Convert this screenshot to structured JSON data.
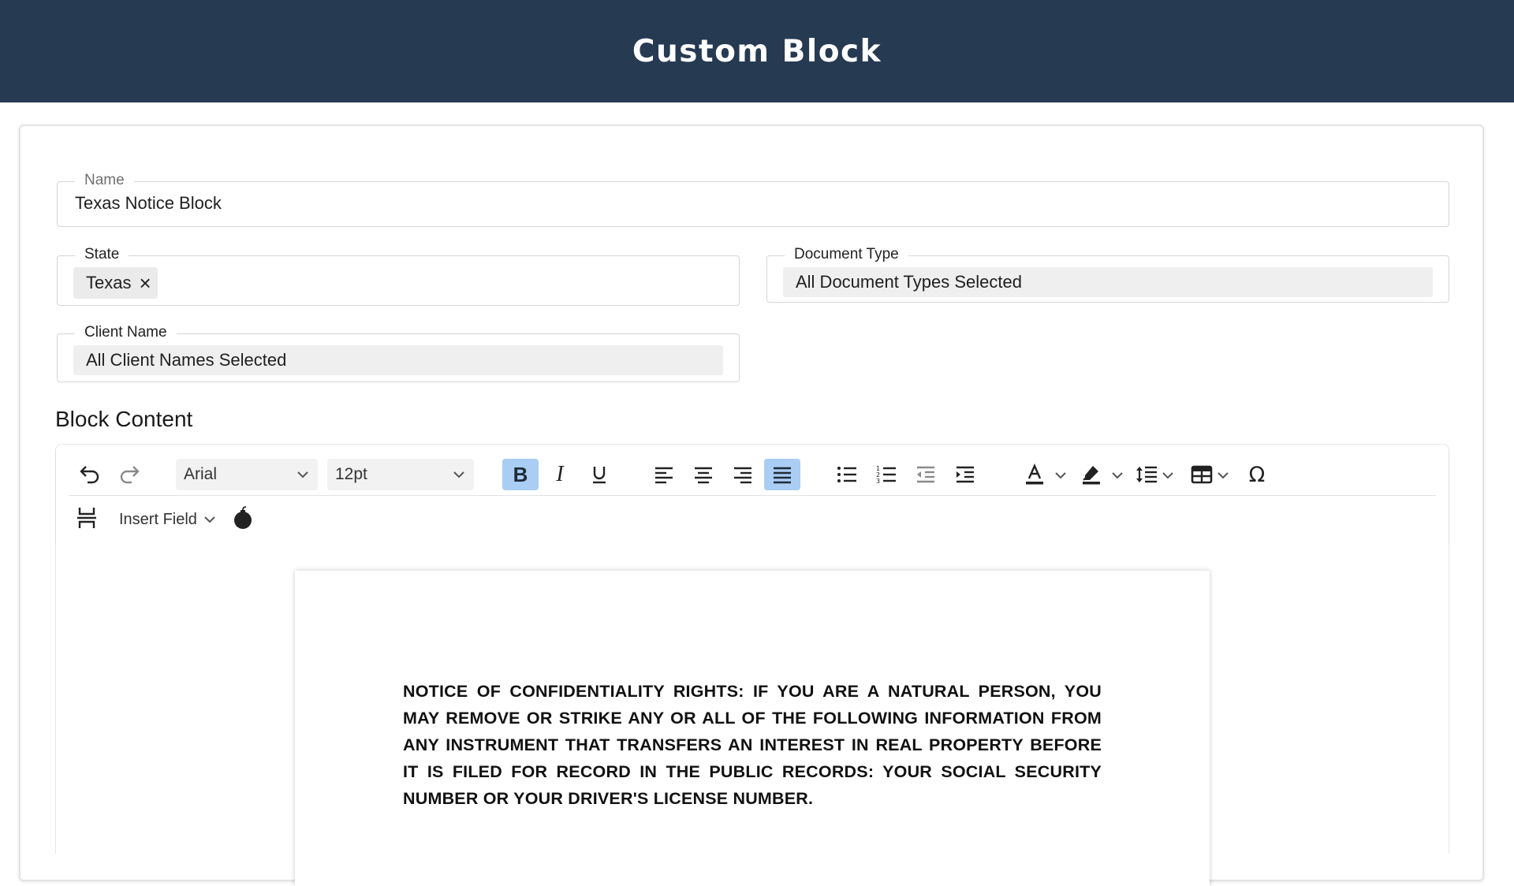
{
  "header": {
    "title": "Custom Block"
  },
  "form": {
    "name": {
      "label": "Name",
      "value": "Texas Notice Block"
    },
    "state": {
      "label": "State",
      "chips": [
        "Texas"
      ],
      "chip_remove_icon": "close-icon"
    },
    "document_type": {
      "label": "Document Type",
      "value": "All Document Types Selected"
    },
    "client_name": {
      "label": "Client Name",
      "value": "All Client Names Selected"
    }
  },
  "block_content": {
    "title": "Block Content",
    "toolbar": {
      "font_family": "Arial",
      "font_size": "12pt",
      "buttons": [
        "undo-icon",
        "redo-icon",
        "bold-icon",
        "italic-icon",
        "underline-icon",
        "align-left-icon",
        "align-center-icon",
        "align-right-icon",
        "align-justify-icon",
        "bullet-list-icon",
        "numbered-list-icon",
        "outdent-icon",
        "indent-icon",
        "text-color-icon",
        "highlight-color-icon",
        "line-height-icon",
        "table-icon",
        "special-character-icon",
        "page-break-icon",
        "bomb-icon"
      ],
      "active_buttons": [
        "bold",
        "align-justify"
      ],
      "insert_field_label": "Insert Field"
    },
    "document_text": "NOTICE OF CONFIDENTIALITY RIGHTS:  IF YOU ARE A NATURAL PERSON, YOU MAY REMOVE OR STRIKE ANY OR ALL OF THE FOLLOWING INFORMATION FROM ANY INSTRUMENT THAT TRANSFERS AN INTEREST IN REAL PROPERTY BEFORE IT IS FILED FOR RECORD IN THE PUBLIC RECORDS:  YOUR SOCIAL SECURITY NUMBER OR YOUR DRIVER'S LICENSE NUMBER."
  },
  "colors": {
    "header_bg": "#263a52",
    "active_button": "#a9cdf3"
  }
}
